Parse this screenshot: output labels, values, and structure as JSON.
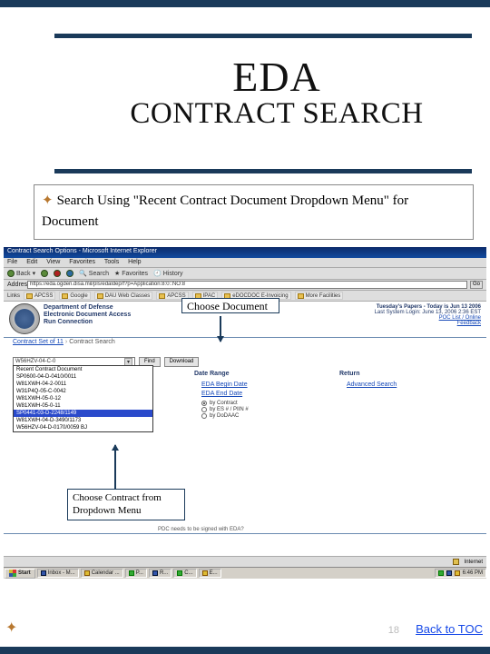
{
  "slide": {
    "title1": "EDA",
    "title2": "CONTRACT SEARCH",
    "subtitle": "Search Using \"Recent Contract Document Dropdown Menu\" for Document"
  },
  "ie": {
    "window_title": "Contract Search Options - Microsoft Internet Explorer",
    "menu": {
      "file": "File",
      "edit": "Edit",
      "view": "View",
      "favorites": "Favorites",
      "tools": "Tools",
      "help": "Help"
    },
    "toolbar": {
      "back": "Back",
      "search": "Search",
      "favorites": "Favorites",
      "history": "History"
    },
    "address_label": "Address",
    "address_value": "https://eda.ogden.disa.mil/pls/edaldep/f?p=Application:8:0::NO:8",
    "go": "Go",
    "links_label": "Links",
    "links": [
      "APCSS",
      "Google",
      "DAU Web Classes",
      "APCSS",
      "IPAC",
      "eDOCDOC E-Invoicing",
      "More Facilities"
    ]
  },
  "app": {
    "org1": "Department of Defense",
    "org2": "Electronic Document Access",
    "org3": "Run Connection",
    "today": "Tuesday's Papers - Today is Jun 13 2006",
    "last_login": "Last System Login: June 13, 2006 2:36 EST",
    "poc_link": "POC List / Online",
    "faq_link": "Feedback",
    "breadcrumb_home": "Contract Set of 11",
    "breadcrumb_cur": "Contract Search",
    "dd_btn_search": "Find",
    "dd_btn_download": "Download",
    "col_date": "Date Range",
    "col_return": "Return",
    "link_elabegin": "EDA Begin Date",
    "link_elaend": "EDA End Date",
    "link_adv": "Advanced Search",
    "radios": [
      "by Contract",
      "by ES # / PIIN #",
      "by DoDAAC"
    ],
    "pdc": "PDC needs to be signed with EDA?"
  },
  "callouts": {
    "c1": "Choose Document",
    "c2": "Choose Contract from Dropdown Menu"
  },
  "dropdown": {
    "selected": "W56HZV-04-C-0",
    "options": [
      "Recent Contract Document",
      "SP0600-04-D-0410/0011",
      "W81XWH-04-2-0011",
      "W31P4Q-05-C-0042",
      "W81XWH-05-0-12",
      "W81XWH-05-0-11",
      "SP0441-03-D-2248/1149",
      "W81XWH-04-D-3490/1173",
      "W56HZV-04-D-0170/0059 BJ"
    ],
    "hl_index": 6
  },
  "status": {
    "internet": "Internet"
  },
  "taskbar": {
    "start": "Start",
    "items": [
      "Inbox - M...",
      "Calendar ...",
      "P...",
      "R...",
      "C...",
      "E..."
    ],
    "clock": "6:46 PM"
  },
  "footer": {
    "back": "Back to TOC",
    "page": "18"
  }
}
